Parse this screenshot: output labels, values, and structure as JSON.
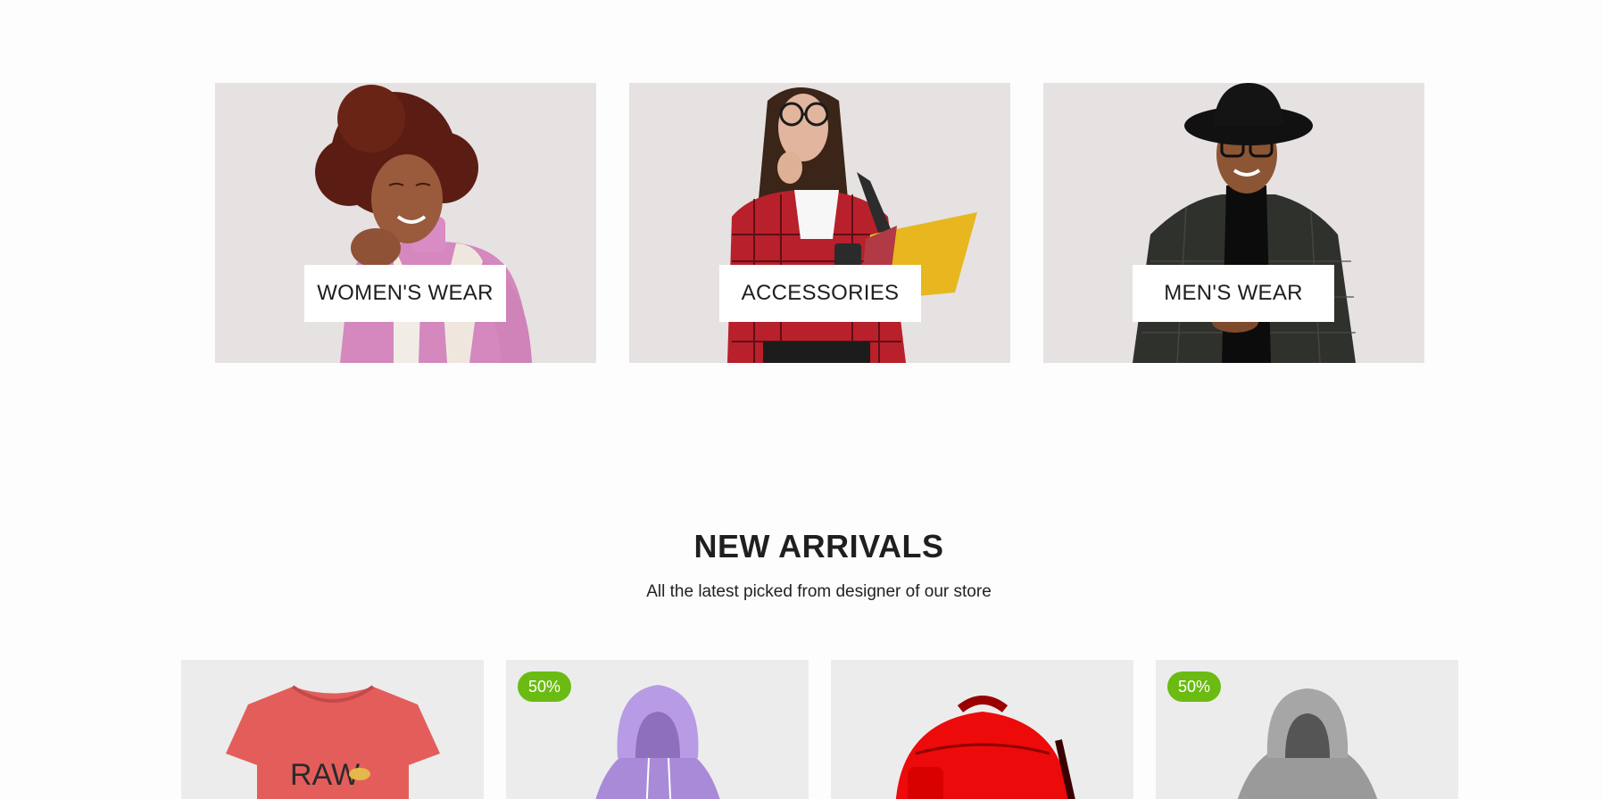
{
  "theme": {
    "badge_color": "#6bbb13",
    "card_bg": "#e5e2e1",
    "product_bg": "#ececec"
  },
  "categories": [
    {
      "label": "WOMEN'S WEAR"
    },
    {
      "label": "ACCESSORIES"
    },
    {
      "label": "MEN'S WEAR"
    }
  ],
  "new_arrivals": {
    "title": "NEW ARRIVALS",
    "subtitle": "All the latest picked from designer of our store"
  },
  "products": [
    {
      "item": "red t-shirt",
      "badge": "",
      "print_text": "RAW"
    },
    {
      "item": "lavender hoodie",
      "badge": "50%"
    },
    {
      "item": "red backpack",
      "badge": ""
    },
    {
      "item": "grey hoodie",
      "badge": "50%"
    }
  ]
}
